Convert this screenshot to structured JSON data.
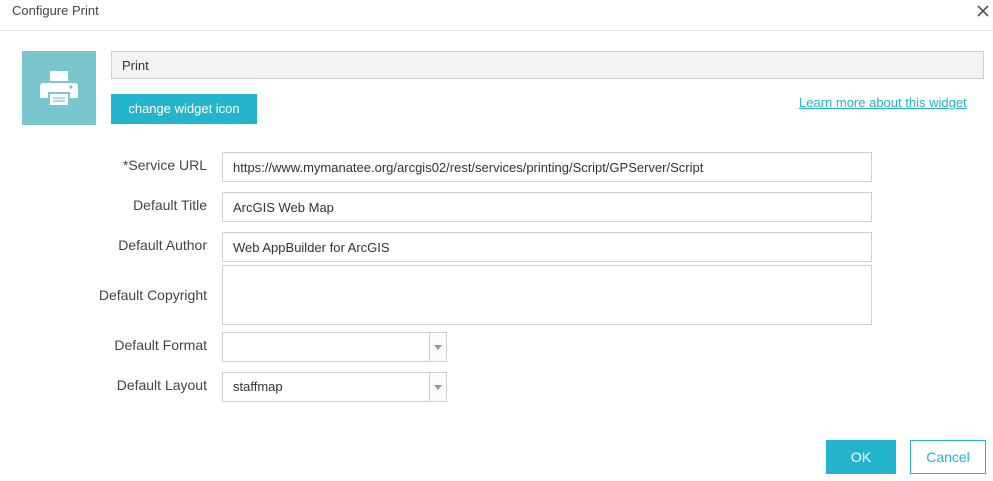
{
  "dialog": {
    "title": "Configure Print",
    "close_icon": "close-icon"
  },
  "widget": {
    "icon": "printer-icon",
    "icon_background": "#7ac6cf",
    "name_value": "Print",
    "change_icon_label": "change widget icon",
    "learn_more_label": "Learn more about this widget"
  },
  "form": {
    "service_url": {
      "label": "*Service URL",
      "value": "https://www.mymanatee.org/arcgis02/rest/services/printing/Script/GPServer/Script"
    },
    "default_title": {
      "label": "Default Title",
      "value": "ArcGIS Web Map"
    },
    "default_author": {
      "label": "Default Author",
      "value": "Web AppBuilder for ArcGIS"
    },
    "default_copyright": {
      "label": "Default Copyright",
      "value": ""
    },
    "default_format": {
      "label": "Default Format",
      "selected": ""
    },
    "default_layout": {
      "label": "Default Layout",
      "selected": "staffmap"
    }
  },
  "actions": {
    "ok_label": "OK",
    "cancel_label": "Cancel"
  },
  "colors": {
    "accent": "#24b5cc",
    "border": "#d0d0d0"
  }
}
